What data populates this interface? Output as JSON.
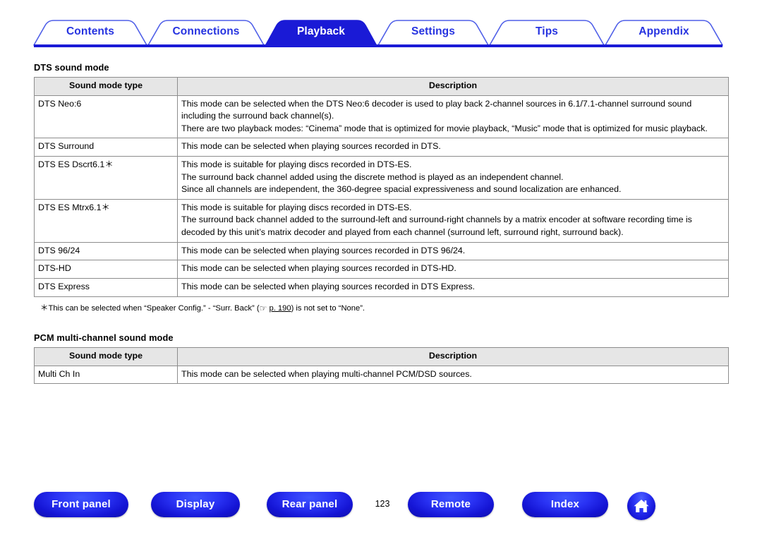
{
  "nav": {
    "tabs": [
      {
        "label": "Contents",
        "active": false
      },
      {
        "label": "Connections",
        "active": false
      },
      {
        "label": "Playback",
        "active": true
      },
      {
        "label": "Settings",
        "active": false
      },
      {
        "label": "Tips",
        "active": false
      },
      {
        "label": "Appendix",
        "active": false
      }
    ],
    "accent_color": "#2633e0",
    "active_tab_bg": "#1a1ad6"
  },
  "sections": [
    {
      "heading": "DTS sound mode",
      "columns": [
        "Sound mode type",
        "Description"
      ],
      "rows": [
        {
          "type": "DTS Neo:6",
          "desc": [
            "This mode can be selected when the DTS Neo:6 decoder is used to play back 2-channel sources in 6.1/7.1-channel surround sound including the surround back channel(s).",
            "There are two playback modes: “Cinema” mode that is optimized for movie playback, “Music” mode that is optimized for music playback."
          ]
        },
        {
          "type": "DTS Surround",
          "desc": [
            "This mode can be selected when playing sources recorded in DTS."
          ]
        },
        {
          "type": "DTS ES Dscrt6.1＊",
          "desc": [
            "This mode is suitable for playing discs recorded in DTS-ES.",
            "The surround back channel added using the discrete method is played as an independent channel.",
            "Since all channels are independent, the 360-degree spacial expressiveness and sound localization are enhanced."
          ]
        },
        {
          "type": "DTS ES Mtrx6.1＊",
          "desc": [
            "This mode is suitable for playing discs recorded in DTS-ES.",
            "The surround back channel added to the surround-left and surround-right channels by a matrix encoder at software recording time is decoded by this unit’s matrix decoder and played from each channel (surround left, surround right, surround back)."
          ]
        },
        {
          "type": "DTS 96/24",
          "desc": [
            "This mode can be selected when playing sources recorded in DTS 96/24."
          ]
        },
        {
          "type": "DTS-HD",
          "desc": [
            "This mode can be selected when playing sources recorded in DTS-HD."
          ]
        },
        {
          "type": "DTS Express",
          "desc": [
            "This mode can be selected when playing sources recorded in DTS Express."
          ]
        }
      ],
      "footnote": {
        "marker": "＊",
        "text_before": "This can be selected when “Speaker Config.” - “Surr. Back” (",
        "hand_icon": "hand-pointing-icon",
        "page_link": "p. 190",
        "text_after": ") is not set to “None”."
      }
    },
    {
      "heading": "PCM multi-channel sound mode",
      "columns": [
        "Sound mode type",
        "Description"
      ],
      "rows": [
        {
          "type": "Multi Ch In",
          "desc": [
            "This mode can be selected when playing multi-channel PCM/DSD sources."
          ]
        }
      ]
    }
  ],
  "footer": {
    "buttons": [
      {
        "label": "Front panel",
        "name": "front-panel-button"
      },
      {
        "label": "Display",
        "name": "display-button"
      },
      {
        "label": "Rear panel",
        "name": "rear-panel-button"
      },
      {
        "label": "Remote",
        "name": "remote-button"
      },
      {
        "label": "Index",
        "name": "index-button"
      }
    ],
    "page_number": "123",
    "home_icon": "home-icon"
  }
}
